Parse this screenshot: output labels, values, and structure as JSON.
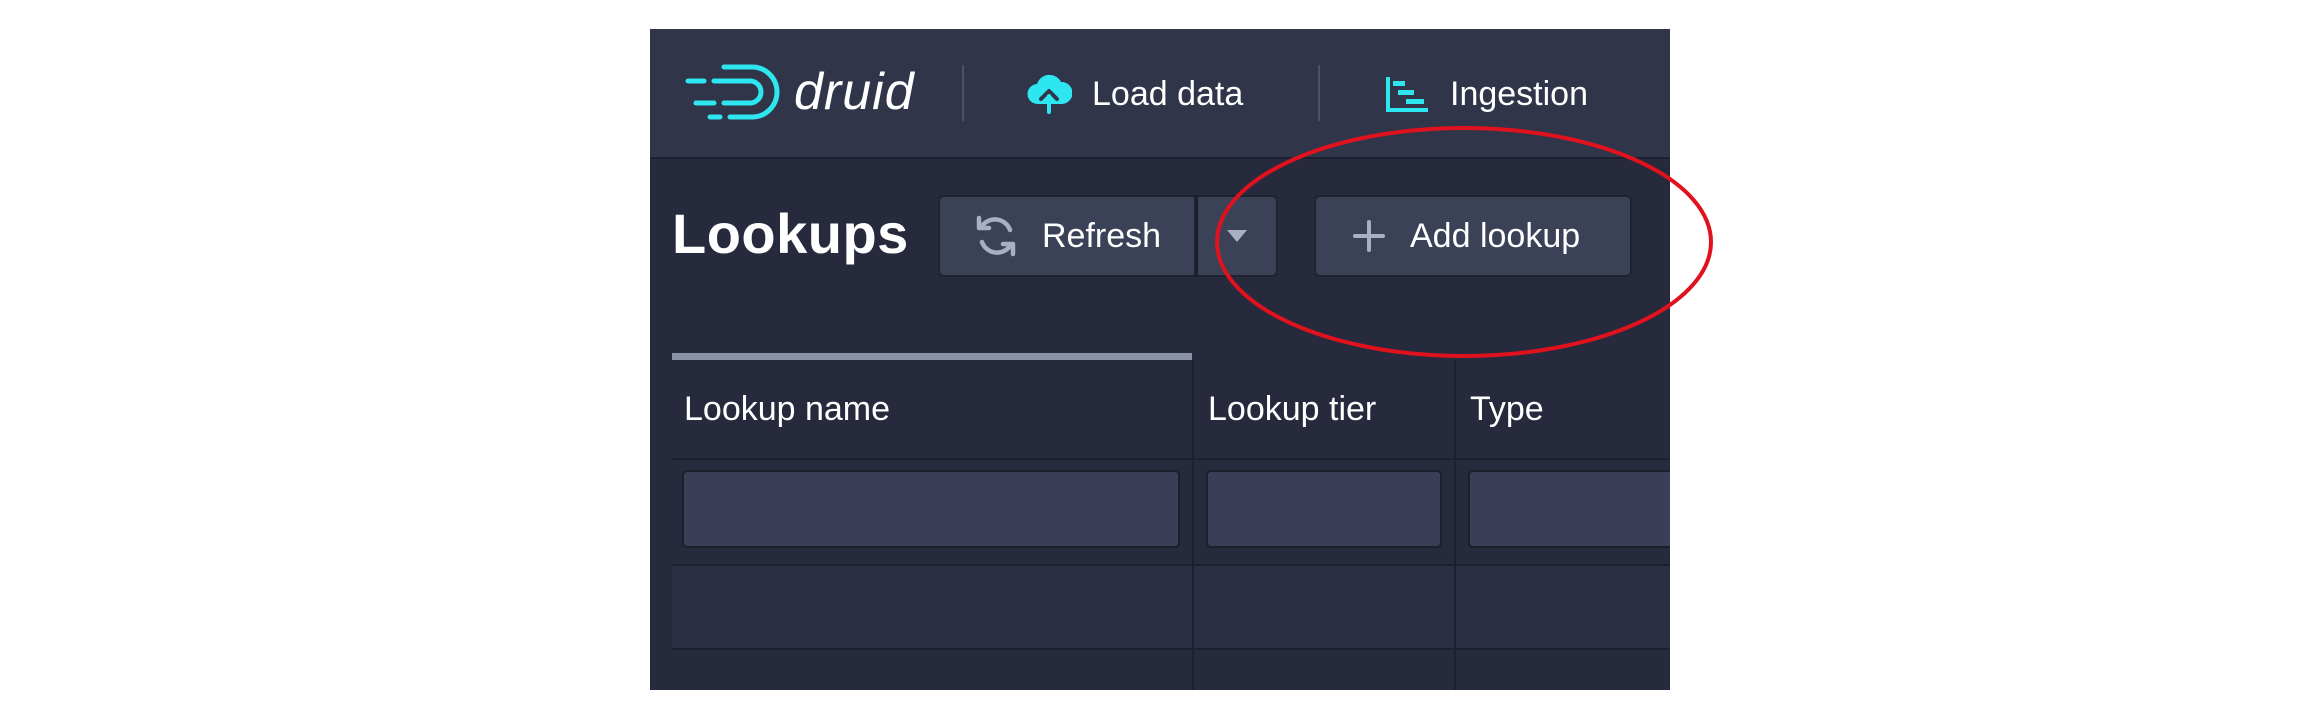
{
  "navbar": {
    "logo_text": "druid",
    "items": [
      {
        "label": "Load data",
        "icon": "cloud-upload-icon"
      },
      {
        "label": "Ingestion",
        "icon": "gantt-chart-icon"
      }
    ]
  },
  "page": {
    "title": "Lookups",
    "refresh_label": "Refresh",
    "add_lookup_label": "Add lookup"
  },
  "table": {
    "columns": [
      "Lookup name",
      "Lookup tier",
      "Type"
    ]
  },
  "colors": {
    "accent": "#2ee6f0",
    "annotation": "#e0121d",
    "background": "#262a3c"
  }
}
